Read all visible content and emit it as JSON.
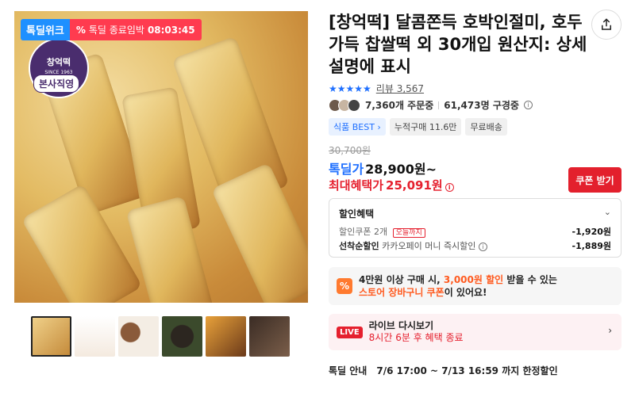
{
  "hero": {
    "badge_brand": "톡딜위크",
    "badge_deal": "톡딜 종료임박",
    "countdown": "08:03:45",
    "brand_name": "창억떡",
    "brand_since": "SINCE 1963",
    "brand_tag": "본사직영"
  },
  "product": {
    "title": "[창억떡] 달콤쫀득 호박인절미, 호두가득 찹쌀떡 외 30개입 원산지: 상세설명에 표시",
    "stars": "★★★★★",
    "review_label": "리뷰 3,567",
    "orders": "7,360개 주문중",
    "buyers": "61,473명 구경중",
    "chips": [
      "식품 BEST",
      "누적구매 11.6만",
      "무료배송"
    ]
  },
  "price": {
    "original": "30,700원",
    "deal_label": "톡딜가",
    "deal_price": "28,900원~",
    "max_label": "최대혜택가",
    "max_price": "25,091원",
    "coupon_button": "쿠폰 받기"
  },
  "discount": {
    "title": "할인혜택",
    "coupon_label": "할인쿠폰 2개",
    "coupon_tag": "오늘까지",
    "coupon_amount": "-1,920원",
    "first_label": "선착순할인",
    "first_desc": "카카오페이 머니 즉시할인",
    "first_amount": "-1,889원"
  },
  "promo": {
    "line1_a": "4만원 이상 구매 시, ",
    "line1_hl": "3,000원 할인",
    "line1_b": " 받을 수 있는",
    "line2_hl": "스토어 장바구니 쿠폰",
    "line2_b": "이 있어요!"
  },
  "live": {
    "badge": "LIVE",
    "title": "라이브 다시보기",
    "sub": "8시간 6분 후 혜택 종료"
  },
  "notice": {
    "label": "톡딜 안내",
    "value": "7/6 17:00 ~ 7/13 16:59 까지 한정할인"
  }
}
